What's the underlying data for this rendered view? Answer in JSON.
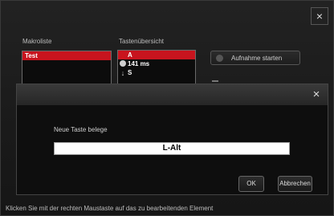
{
  "main": {
    "close_glyph": "×",
    "macro_list_label": "Makroliste",
    "macro_items": [
      "Test"
    ],
    "key_overview_label": "Tastenübersicht",
    "key_items": [
      {
        "icon": "arrow-down-red-icon",
        "text": "A"
      },
      {
        "icon": "clock-icon",
        "text": "141 ms"
      },
      {
        "icon": "arrow-down-gray-icon",
        "text": "S"
      }
    ],
    "record_button_label": "Aufnahme starten",
    "status_text": "Klicken Sie mit der rechten Maustaste auf das zu bearbeitenden Element"
  },
  "dialog": {
    "close_glyph": "×",
    "prompt": "Neue Taste belege",
    "key_value": "L-Alt",
    "ok_label": "OK",
    "cancel_label": "Abbrechen"
  },
  "colors": {
    "selection_red": "#c8141e",
    "arrow_red": "#e01010",
    "background": "#1b1b1b"
  }
}
